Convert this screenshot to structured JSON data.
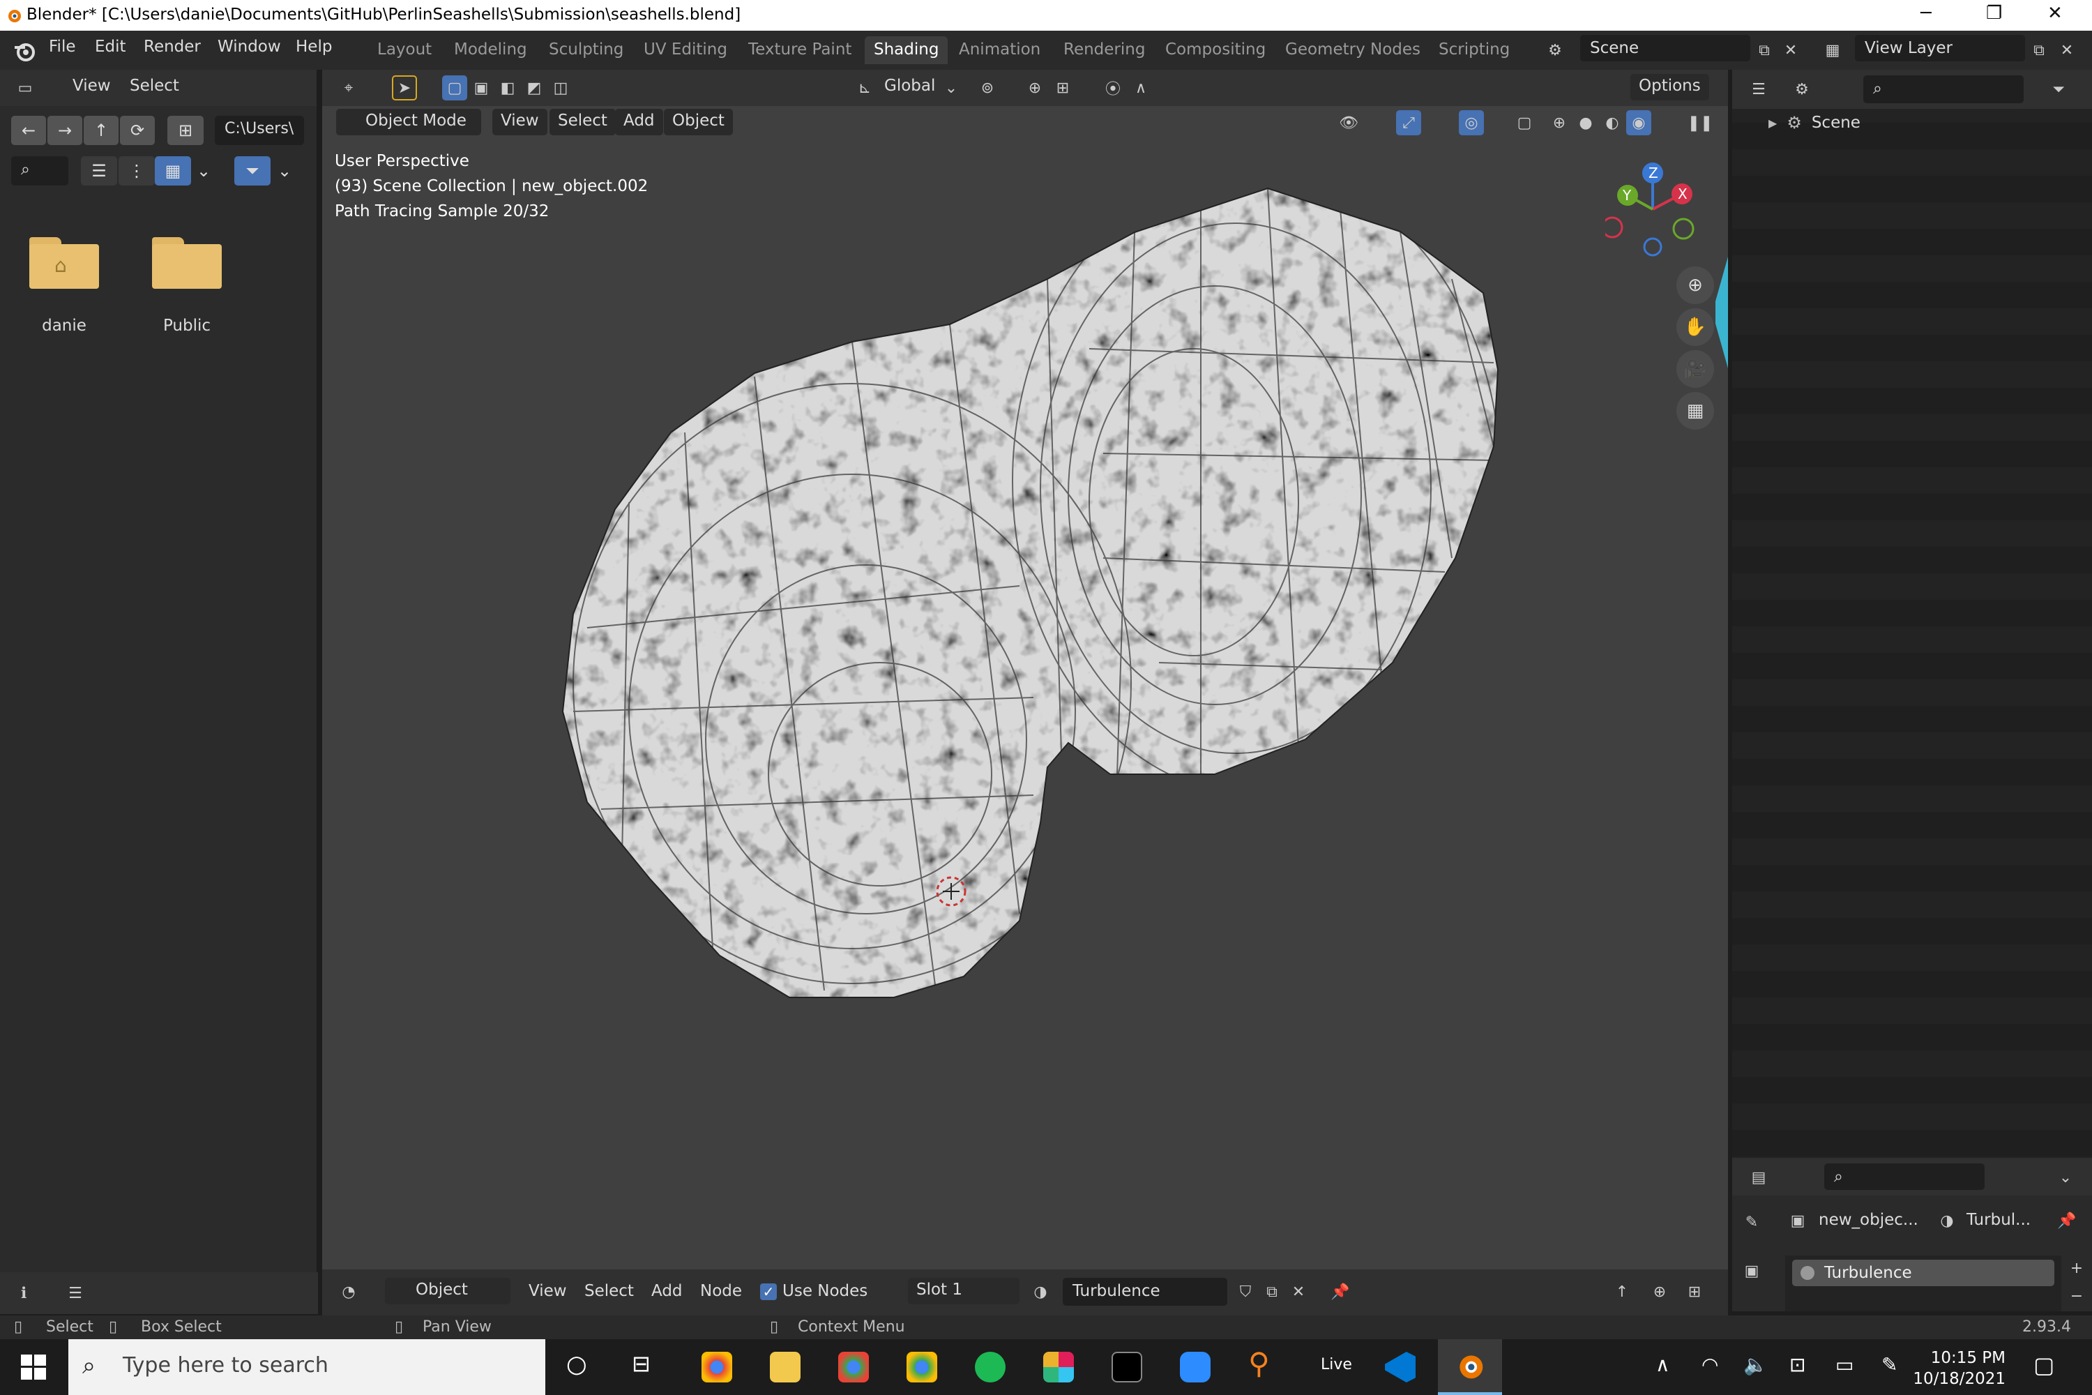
{
  "window": {
    "title": "Blender* [C:\\Users\\danie\\Documents\\GitHub\\PerlinSeashells\\Submission\\seashells.blend]"
  },
  "menu": [
    "File",
    "Edit",
    "Render",
    "Window",
    "Help"
  ],
  "workspace_tabs": [
    "Layout",
    "Modeling",
    "Sculpting",
    "UV Editing",
    "Texture Paint",
    "Shading",
    "Animation",
    "Rendering",
    "Compositing",
    "Geometry Nodes",
    "Scripting"
  ],
  "active_workspace": "Shading",
  "scene_field": "Scene",
  "view_layer_field": "View Layer",
  "file_browser": {
    "menu": [
      "View",
      "Select"
    ],
    "path": "C:\\Users\\",
    "items": [
      {
        "name": "danie",
        "icon": "home-folder-icon"
      },
      {
        "name": "Public",
        "icon": "folder-icon"
      }
    ]
  },
  "viewport_header": {
    "mode": "Object Mode",
    "menus": [
      "View",
      "Select",
      "Add",
      "Object"
    ],
    "orientation": "Global",
    "options_label": "Options"
  },
  "viewport_overlay": {
    "line1": "User Perspective",
    "line2": "(93) Scene Collection | new_object.002",
    "line3": "Path Tracing Sample 20/32"
  },
  "gizmo": {
    "x": "X",
    "y": "Y",
    "z": "Z"
  },
  "outliner": {
    "root": "Scene"
  },
  "properties": {
    "object_name": "new_objec...",
    "material_short": "Turbul...",
    "material_slot_item": "Turbulence"
  },
  "node_header": {
    "editor_object": "Object",
    "menus": [
      "View",
      "Select",
      "Add",
      "Node"
    ],
    "use_nodes_label": "Use Nodes",
    "use_nodes_checked": true,
    "slot": "Slot 1",
    "material": "Turbulence"
  },
  "status_bar": {
    "select": "Select",
    "box_select": "Box Select",
    "pan_view": "Pan View",
    "context_menu": "Context Menu",
    "version": "2.93.4"
  },
  "taskbar": {
    "search_placeholder": "Type here to search",
    "live_label": "Live",
    "time": "10:15 PM",
    "date": "10/18/2021"
  },
  "colors": {
    "accent": "#4772b3",
    "active_tab": "#3d3d3d",
    "viewport_bg": "#404040",
    "folder": "#e8c06f"
  }
}
